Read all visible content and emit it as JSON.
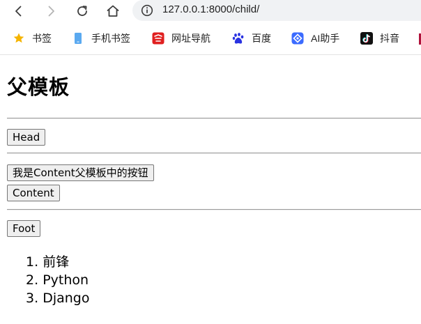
{
  "browser": {
    "url": "127.0.0.1:8000/child/",
    "nav": {
      "back": "arrow-left-icon",
      "forward": "arrow-right-icon",
      "reload": "reload-icon",
      "home": "home-icon"
    },
    "bookmarks": [
      {
        "label": "书签",
        "icon": "star-icon",
        "color": "#f5b400"
      },
      {
        "label": "手机书签",
        "icon": "phone-icon",
        "color": "#4a90e2"
      },
      {
        "label": "网址导航",
        "icon": "navigation-icon",
        "color": "#e02020"
      },
      {
        "label": "百度",
        "icon": "baidu-paw-icon",
        "color": "#2932e1"
      },
      {
        "label": "AI助手",
        "icon": "ai-assistant-icon",
        "color": "#3b6bff"
      },
      {
        "label": "抖音",
        "icon": "douyin-icon",
        "color": "#000000"
      }
    ]
  },
  "page": {
    "title": "父模板",
    "buttons": {
      "head": "Head",
      "parent_content": "我是Content父模板中的按钮",
      "content": "Content",
      "foot": "Foot"
    },
    "list": [
      {
        "marker": "1.",
        "text": "前锋"
      },
      {
        "marker": "2.",
        "text": "Python"
      },
      {
        "marker": "3.",
        "text": "Django"
      }
    ]
  }
}
